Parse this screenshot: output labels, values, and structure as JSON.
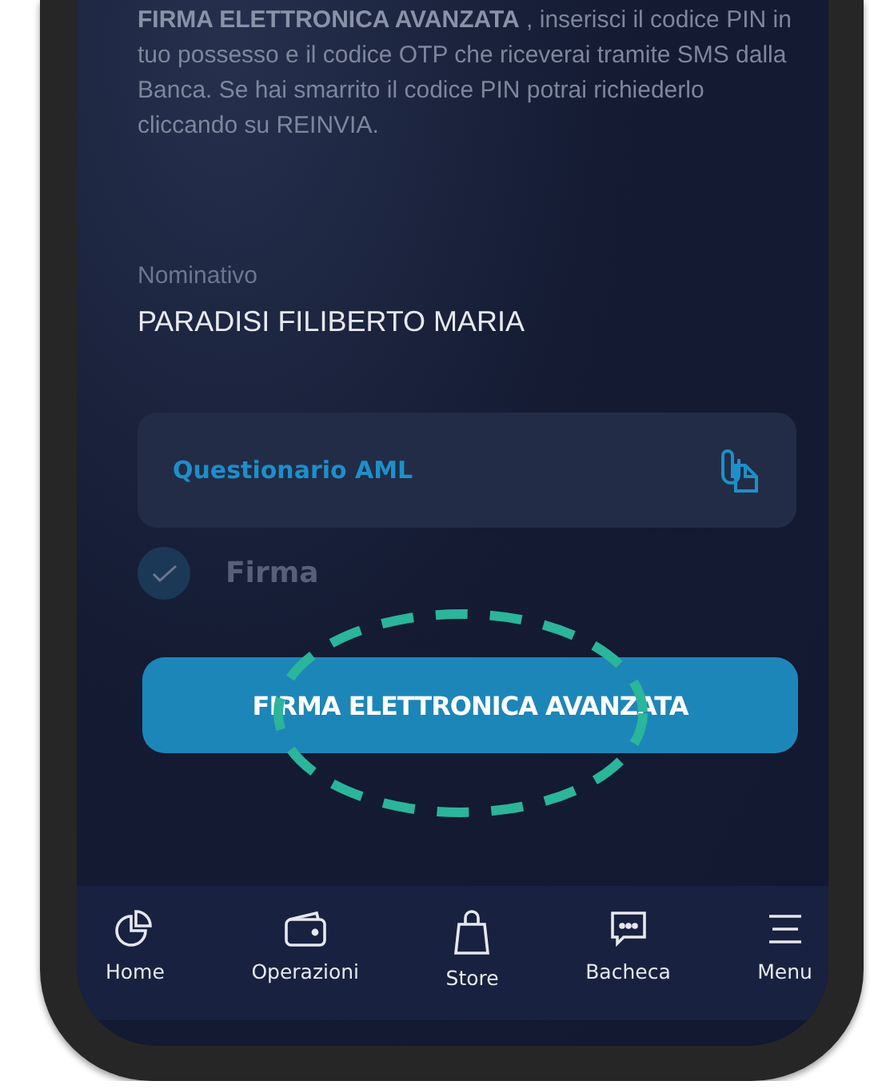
{
  "intro": {
    "text": "**FIRMA ELETTRONICA AVANZATA** , inserisci il codice PIN in tuo possesso e il codice OTP che riceverai tramite SMS dalla Banca. Se hai smarrito il codice PIN potrai richiederlo cliccando su REINVIA."
  },
  "nominativo": {
    "label": "Nominativo",
    "value": "PARADISI FILIBERTO MARIA"
  },
  "document": {
    "label": "Questionario AML"
  },
  "signature": {
    "label": "Firma",
    "checked": true
  },
  "action_button": {
    "label": "FIRMA ELETTRONICA AVANZATA"
  },
  "bottom_nav": [
    {
      "kind": "home",
      "label": "Home"
    },
    {
      "kind": "wallet",
      "label": "Operazioni"
    },
    {
      "kind": "store",
      "label": "Store"
    },
    {
      "kind": "chat",
      "label": "Bacheca"
    },
    {
      "kind": "menu",
      "label": "Menu"
    }
  ]
}
